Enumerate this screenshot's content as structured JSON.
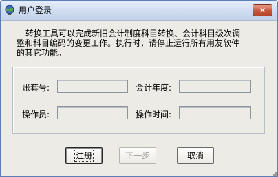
{
  "window": {
    "title": "用户登录",
    "close_label": "✕"
  },
  "description": {
    "line1": "转换工具可以完成新旧会计制度科目转换、会计科目级次调",
    "line2": "整和科目编码的变更工作。执行时，请停止运行所有用友软件",
    "line3": "的其它功能。"
  },
  "form": {
    "account_set_label": "账套号:",
    "account_set_value": "",
    "fiscal_year_label": "会计年度:",
    "fiscal_year_value": "",
    "operator_label": "操作员:",
    "operator_value": "",
    "operation_time_label": "操作时间:",
    "operation_time_value": ""
  },
  "buttons": {
    "register": "注册",
    "next": "下一步",
    "cancel": "取消"
  },
  "colors": {
    "window_bg": "#ecebe5",
    "close_button": "#c65438",
    "disabled_text": "#a5a49c"
  }
}
